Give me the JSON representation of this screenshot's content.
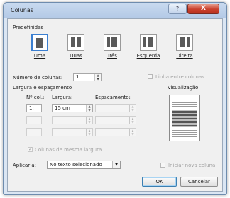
{
  "window": {
    "title": "Colunas",
    "help_glyph": "?",
    "close_glyph": "X"
  },
  "presets": {
    "label": "Predefinidas",
    "items": [
      {
        "label": "Uma",
        "columns": 1,
        "selected": true
      },
      {
        "label": "Duas",
        "columns": 2
      },
      {
        "label": "Três",
        "columns": 3
      },
      {
        "label": "Esquerda",
        "columns": "left"
      },
      {
        "label": "Direita",
        "columns": "right"
      }
    ]
  },
  "num_columns": {
    "label": "Número de colunas:",
    "value": "1"
  },
  "line_between": {
    "label": "Linha entre colunas",
    "checked": false
  },
  "width_spacing": {
    "label": "Largura e espaçamento",
    "col_header": "Nº col.:",
    "width_header": "Largura:",
    "spacing_header": "Espaçamento:",
    "rows": [
      {
        "col": "1:",
        "width": "15 cm",
        "spacing": ""
      },
      {
        "col": "",
        "width": "",
        "spacing": ""
      },
      {
        "col": "",
        "width": "",
        "spacing": ""
      }
    ]
  },
  "preview": {
    "label": "Visualização"
  },
  "equal_width": {
    "label": "Colunas de mesma largura",
    "checked": true
  },
  "apply_to": {
    "label": "Aplicar a:",
    "value": "No texto selecionado"
  },
  "new_column": {
    "label": "Iniciar nova coluna",
    "checked": false
  },
  "buttons": {
    "ok": "OK",
    "cancel": "Cancelar"
  },
  "spin_arrows": {
    "up": "▲",
    "down": "▼"
  },
  "combo_arrow": "▼",
  "colors": {
    "title_bar": "#b3c9e6",
    "close_button": "#c9402c",
    "selected_border": "#3b7fd0"
  }
}
